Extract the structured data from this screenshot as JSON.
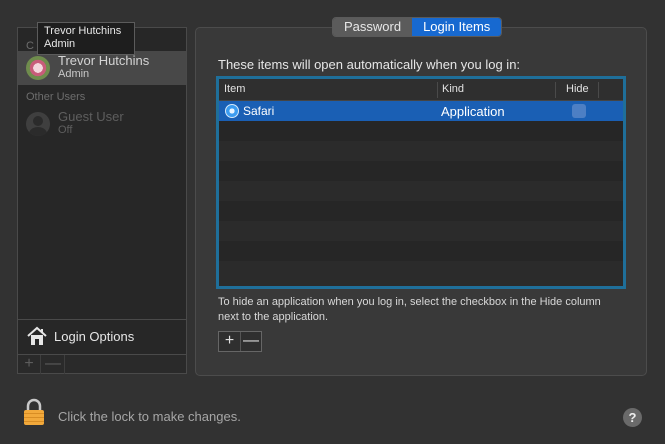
{
  "tooltip": {
    "name": "Trevor Hutchins",
    "role": "Admin"
  },
  "sidebar": {
    "current_user_heading": "C",
    "current_user": {
      "name": "Trevor Hutchins",
      "role": "Admin"
    },
    "other_users_heading": "Other Users",
    "other_users": [
      {
        "name": "Guest User",
        "status": "Off"
      }
    ],
    "login_options_label": "Login Options",
    "add_symbol": "+",
    "remove_symbol": "—"
  },
  "tabs": [
    {
      "label": "Password",
      "active": false
    },
    {
      "label": "Login Items",
      "active": true
    }
  ],
  "login_items": {
    "description": "These items will open automatically when you log in:",
    "columns": [
      "Item",
      "Kind",
      "Hide"
    ],
    "rows": [
      {
        "item": "Safari",
        "kind": "Application",
        "hide": false,
        "icon": "safari-icon"
      }
    ],
    "hint": "To hide an application when you log in, select the checkbox in the Hide column next to the application.",
    "add_symbol": "+",
    "remove_symbol": "—"
  },
  "footer": {
    "lock_label": "Click the lock to make changes.",
    "help_symbol": "?"
  },
  "colors": {
    "accent": "#1769d0",
    "selected_row": "#1a5fb4",
    "table_focus_ring": "#1f6f9a"
  }
}
